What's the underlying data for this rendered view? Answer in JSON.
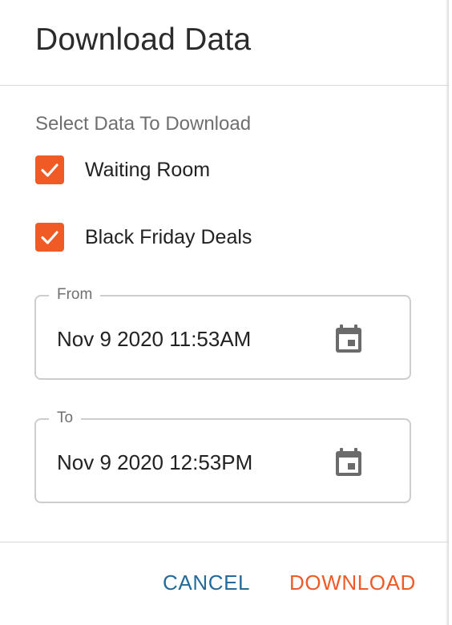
{
  "dialog": {
    "title": "Download Data",
    "section_label": "Select Data To Download",
    "options": [
      {
        "label": "Waiting Room",
        "checked": true
      },
      {
        "label": "Black Friday Deals",
        "checked": true
      }
    ],
    "from": {
      "label": "From",
      "value": "Nov 9 2020 11:53AM",
      "icon": "calendar-icon"
    },
    "to": {
      "label": "To",
      "value": "Nov 9 2020 12:53PM",
      "icon": "calendar-icon"
    },
    "actions": {
      "cancel": "CANCEL",
      "download": "DOWNLOAD"
    }
  },
  "colors": {
    "accent": "#f05a24",
    "cancel": "#246b9a",
    "title_text": "#2b2b2b",
    "muted_text": "#6f6f6f",
    "border": "#cdcdcd"
  }
}
